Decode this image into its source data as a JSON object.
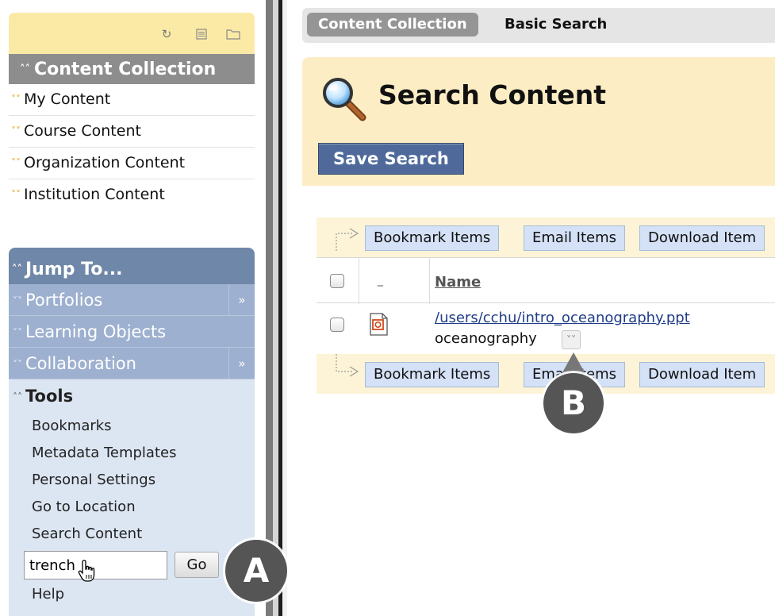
{
  "sidebar": {
    "content_collection": {
      "title": "Content Collection",
      "items": [
        {
          "label": "My Content"
        },
        {
          "label": "Course Content"
        },
        {
          "label": "Organization Content"
        },
        {
          "label": "Institution Content"
        }
      ]
    },
    "jump_to": {
      "title": "Jump To...",
      "items": [
        {
          "label": "Portfolios"
        },
        {
          "label": "Learning Objects"
        },
        {
          "label": "Collaboration"
        }
      ]
    },
    "tools": {
      "title": "Tools",
      "links": [
        {
          "label": "Bookmarks"
        },
        {
          "label": "Metadata Templates"
        },
        {
          "label": "Personal Settings"
        },
        {
          "label": "Go to Location"
        },
        {
          "label": "Search Content"
        }
      ],
      "search_value": "trench",
      "go_label": "Go",
      "help_label": "Help"
    }
  },
  "breadcrumb": {
    "items": [
      "Content Collection",
      "Basic Search"
    ]
  },
  "main": {
    "title": "Search Content",
    "save_search_label": "Save Search",
    "actions": [
      "Bookmark Items",
      "Email Items",
      "Download Item"
    ],
    "list": {
      "type_header": "_",
      "name_header": "Name"
    },
    "result": {
      "path": "/users/cchu/intro_oceanography.ppt",
      "description": "oceanography"
    }
  },
  "callouts": {
    "a": "A",
    "b": "B"
  },
  "colors": {
    "sidebar_toolbar": "#fbeaa6",
    "panel_header": "#8d8d8d",
    "jump_header": "#6f87a8",
    "jump_item": "#9db0cf",
    "title_area": "#fcedc4",
    "save_button": "#4f6a9a",
    "action_button": "#d4e1f6",
    "link": "#1f3c88"
  }
}
